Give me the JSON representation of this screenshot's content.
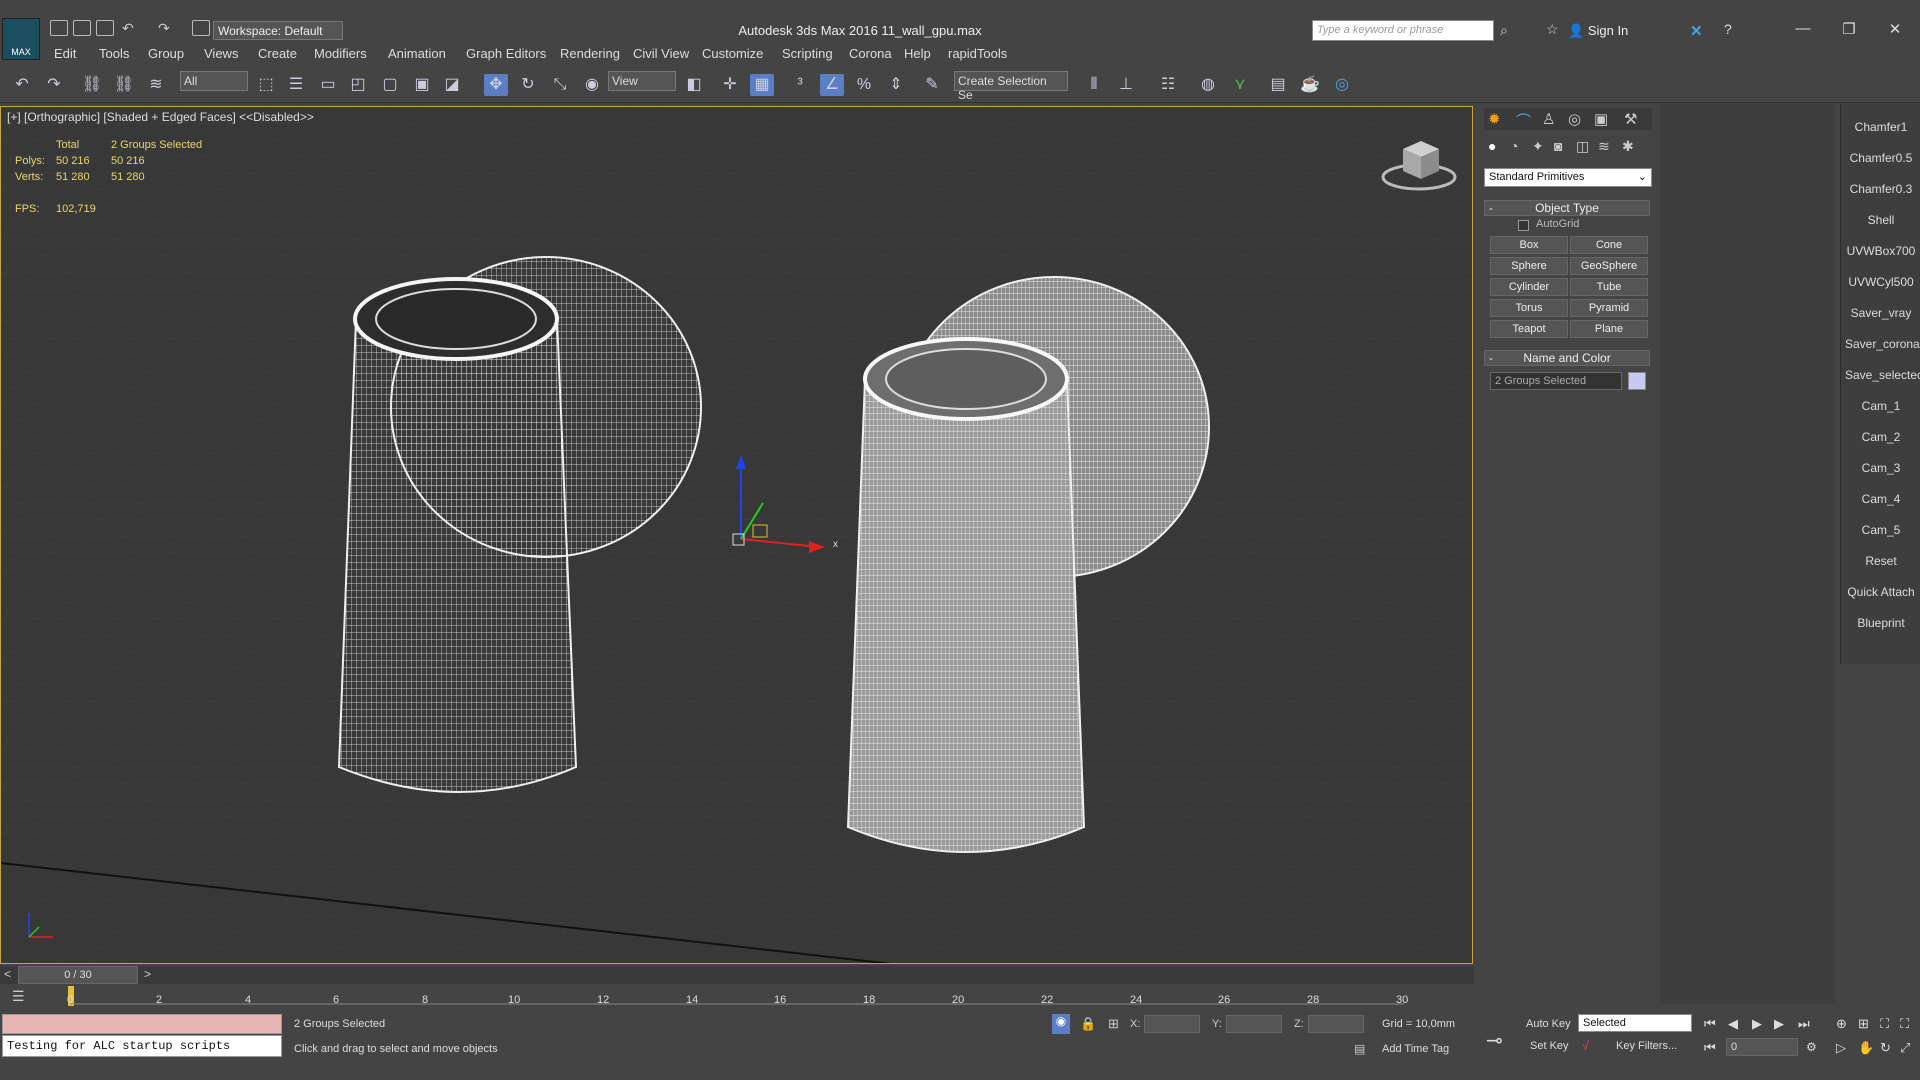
{
  "app": {
    "logo_text": "MAX",
    "title": "Autodesk 3ds Max 2016    11_wall_gpu.max",
    "workspace": "Workspace: Default",
    "search_placeholder": "Type a keyword or phrase",
    "sign_in": "Sign In"
  },
  "menu": [
    "Edit",
    "Tools",
    "Group",
    "Views",
    "Create",
    "Modifiers",
    "Animation",
    "Graph Editors",
    "Rendering",
    "Civil View",
    "Customize",
    "Scripting",
    "Corona",
    "Help",
    "rapidTools"
  ],
  "toolbar": {
    "filter": "All",
    "ref_coord": "View",
    "selection_set": "Create Selection Se"
  },
  "viewport": {
    "label": "[+] [Orthographic] [Shaded + Edged Faces]  <<Disabled>>",
    "stats": {
      "total_label": "Total",
      "selected_label": "2 Groups Selected",
      "polys_label": "Polys:",
      "polys_total": "50 216",
      "polys_sel": "50 216",
      "verts_label": "Verts:",
      "verts_total": "51 280",
      "verts_sel": "51 280",
      "fps_label": "FPS:",
      "fps": "102,719"
    },
    "gizmo_x": "x"
  },
  "command_panel": {
    "category": "Standard Primitives",
    "object_type_title": "Object Type",
    "autogrid": "AutoGrid",
    "buttons": [
      "Box",
      "Cone",
      "Sphere",
      "GeoSphere",
      "Cylinder",
      "Tube",
      "Torus",
      "Pyramid",
      "Teapot",
      "Plane"
    ],
    "name_color_title": "Name and Color",
    "name_value": "2 Groups Selected",
    "object_color": "#c8c8f0",
    "minus": "-"
  },
  "scripts": [
    "Chamfer1",
    "Chamfer0.5",
    "Chamfer0.3",
    "Shell",
    "UVWBox700",
    "UVWCyl500",
    "Saver_vray",
    "Saver_corona",
    "Save_selectec",
    "Cam_1",
    "Cam_2",
    "Cam_3",
    "Cam_4",
    "Cam_5",
    "Reset",
    "Quick Attach",
    "Blueprint"
  ],
  "timeline": {
    "frame": "0 / 30",
    "prev": "<",
    "next": ">",
    "ticks": [
      "0",
      "2",
      "4",
      "6",
      "8",
      "10",
      "12",
      "14",
      "16",
      "18",
      "20",
      "22",
      "24",
      "26",
      "28",
      "30"
    ]
  },
  "status": {
    "maxscript_output": "Testing for ALC startup scripts",
    "selection": "2 Groups Selected",
    "prompt": "Click and drag to select and move objects",
    "x_label": "X:",
    "y_label": "Y:",
    "z_label": "Z:",
    "grid": "Grid = 10,0mm",
    "add_time_tag": "Add Time Tag",
    "auto_key": "Auto Key",
    "set_key": "Set Key",
    "key_mode": "Selected",
    "key_filters": "Key Filters...",
    "current_frame": "0"
  }
}
